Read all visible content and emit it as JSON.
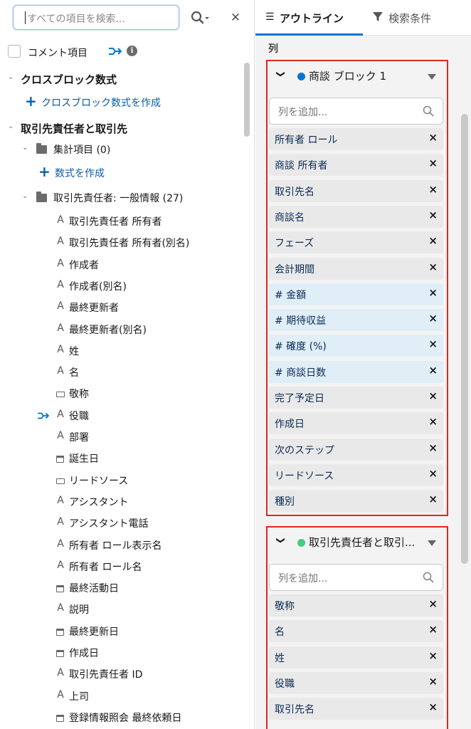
{
  "left": {
    "search": {
      "placeholder": "すべての項目を検索..."
    },
    "comment_label": "コメント項目",
    "sections": {
      "cross_block": {
        "title": "クロスブロック数式",
        "add_label": "クロスブロック数式を作成"
      },
      "contacts": {
        "title": "取引先責任者と取引先",
        "summary_folder": "集計項目 (0)",
        "add_formula_label": "数式を作成",
        "general_folder": "取引先責任者: 一般情報 (27)",
        "fields": [
          {
            "type": "A",
            "label": "取引先責任者 所有者"
          },
          {
            "type": "A",
            "label": "取引先責任者 所有者(別名)"
          },
          {
            "type": "A",
            "label": "作成者"
          },
          {
            "type": "A",
            "label": "作成者(別名)"
          },
          {
            "type": "A",
            "label": "最終更新者"
          },
          {
            "type": "A",
            "label": "最終更新者(別名)"
          },
          {
            "type": "A",
            "label": "姓"
          },
          {
            "type": "A",
            "label": "名"
          },
          {
            "type": "picklist",
            "label": "敬称"
          },
          {
            "type": "A",
            "label": "役職",
            "flow": true
          },
          {
            "type": "A",
            "label": "部署"
          },
          {
            "type": "date",
            "label": "誕生日"
          },
          {
            "type": "picklist",
            "label": "リードソース"
          },
          {
            "type": "A",
            "label": "アシスタント"
          },
          {
            "type": "A",
            "label": "アシスタント電話"
          },
          {
            "type": "A",
            "label": "所有者 ロール表示名"
          },
          {
            "type": "A",
            "label": "所有者 ロール名"
          },
          {
            "type": "date",
            "label": "最終活動日"
          },
          {
            "type": "A",
            "label": "説明"
          },
          {
            "type": "date",
            "label": "最終更新日"
          },
          {
            "type": "date",
            "label": "作成日"
          },
          {
            "type": "A",
            "label": "取引先責任者 ID"
          },
          {
            "type": "A",
            "label": "上司"
          },
          {
            "type": "date",
            "label": "登録情報照会 最終依頼日"
          }
        ]
      }
    }
  },
  "right": {
    "tabs": {
      "outline": "アウトライン",
      "filters": "検索条件"
    },
    "columns_heading": "列",
    "blocks": [
      {
        "name": "商談 ブロック 1",
        "dot_color": "#0176d3",
        "add_placeholder": "列を追加...",
        "columns": [
          {
            "label": "所有者 ロール",
            "numeric": false
          },
          {
            "label": "商談 所有者",
            "numeric": false
          },
          {
            "label": "取引先名",
            "numeric": false
          },
          {
            "label": "商談名",
            "numeric": false
          },
          {
            "label": "フェーズ",
            "numeric": false
          },
          {
            "label": "会計期間",
            "numeric": false
          },
          {
            "label": "# 金額",
            "numeric": true
          },
          {
            "label": "# 期待収益",
            "numeric": true
          },
          {
            "label": "# 確度 (%)",
            "numeric": true
          },
          {
            "label": "# 商談日数",
            "numeric": true
          },
          {
            "label": "完了予定日",
            "numeric": false
          },
          {
            "label": "作成日",
            "numeric": false
          },
          {
            "label": "次のステップ",
            "numeric": false
          },
          {
            "label": "リードソース",
            "numeric": false
          },
          {
            "label": "種別",
            "numeric": false
          }
        ]
      },
      {
        "name": "取引先責任者と取引...",
        "dot_color": "#4bca81",
        "add_placeholder": "列を追加...",
        "columns": [
          {
            "label": "敬称",
            "numeric": false
          },
          {
            "label": "名",
            "numeric": false
          },
          {
            "label": "姓",
            "numeric": false
          },
          {
            "label": "役職",
            "numeric": false
          },
          {
            "label": "取引先名",
            "numeric": false
          }
        ]
      }
    ],
    "remove_symbol": "×"
  }
}
